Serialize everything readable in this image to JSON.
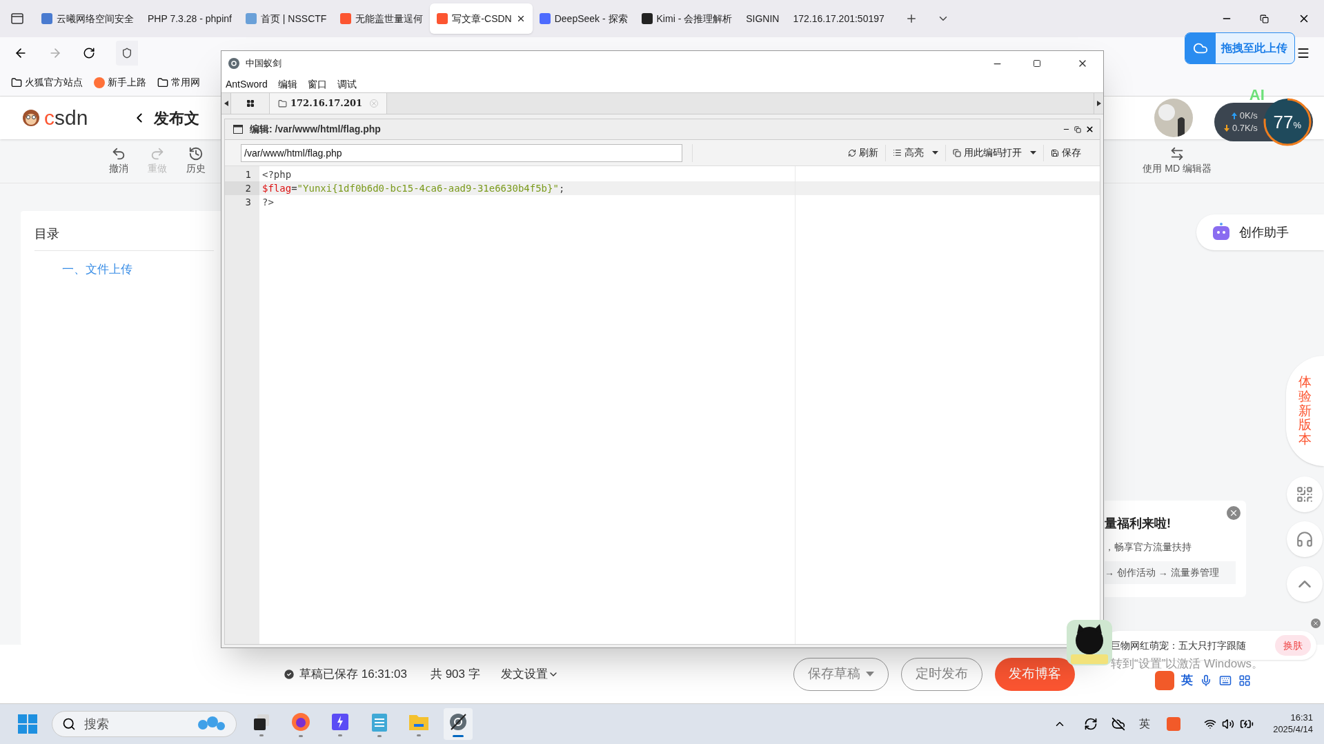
{
  "browser": {
    "tabs": [
      {
        "title": "云曦网络空间安全",
        "selected": false,
        "color": "#4a7bd0"
      },
      {
        "title": "PHP 7.3.28 - phpinf",
        "selected": false
      },
      {
        "title": "首页 | NSSCTF",
        "selected": false,
        "color": "#6aa0d8"
      },
      {
        "title": "无能盖世量逞何",
        "selected": false,
        "color": "#fc5531"
      },
      {
        "title": "写文章-CSDN",
        "selected": true,
        "color": "#fc5531"
      },
      {
        "title": "DeepSeek - 探索",
        "selected": false,
        "color": "#4d6bfe"
      },
      {
        "title": "Kimi - 会推理解析",
        "selected": false,
        "color": "#222222"
      },
      {
        "title": "SIGNIN",
        "selected": false
      },
      {
        "title": "172.16.17.201:50197",
        "selected": false
      }
    ],
    "bookmarks": [
      "火狐官方站点",
      "新手上路",
      "常用网"
    ],
    "upload_button": "拖拽至此上传"
  },
  "csdn": {
    "logo": "csdn",
    "page_title": "发布文",
    "toolbar": [
      {
        "label": "撤消",
        "disabled": false
      },
      {
        "label": "重做",
        "disabled": true
      },
      {
        "label": "历史",
        "disabled": false
      }
    ],
    "md_editor": "使用 MD 编辑器",
    "toc": {
      "title": "目录",
      "items": [
        "一、文件上传"
      ]
    },
    "assistant": "创作助手",
    "side_tabs": "体验新版本",
    "status": {
      "saved": "草稿已保存 16:31:03",
      "count": "共 903 字",
      "settings": "发文设置"
    },
    "buttons": [
      {
        "label": "保存草稿",
        "kind": "dropdown"
      },
      {
        "label": "定时发布",
        "kind": "outline"
      },
      {
        "label": "发布博客",
        "kind": "primary"
      }
    ],
    "promo": {
      "title": "量福利来啦!",
      "line": "，畅享官方流量扶持",
      "path": "→ 创作活动 → 流量券管理"
    }
  },
  "net_widget": {
    "badge": "AI",
    "up": "0K/s",
    "down": "0.7K/s",
    "percent": "77",
    "unit": "%"
  },
  "antsword": {
    "title": "中国蚁剑",
    "menu": [
      "AntSword",
      "编辑",
      "窗口",
      "调试"
    ],
    "tab": "172.16.17.201",
    "panel_title": "编辑: /var/www/html/flag.php",
    "path": "/var/www/html/flag.php",
    "actions": [
      {
        "label": "刷新",
        "kind": "refresh"
      },
      {
        "label": "高亮",
        "kind": "list-dropdown"
      },
      {
        "label": "用此编码打开",
        "kind": "encoding-dropdown"
      },
      {
        "label": "保存",
        "kind": "save"
      }
    ],
    "lines": [
      {
        "number": "1",
        "current": false,
        "tokens": [
          {
            "text": "<?php",
            "kind": "plain"
          }
        ]
      },
      {
        "number": "2",
        "current": true,
        "tokens": [
          {
            "text": "$flag",
            "kind": "variable"
          },
          {
            "text": "=",
            "kind": "operator"
          },
          {
            "text": "\"Yunxi{1df0b6d0-bc15-4ca6-aad9-31e6630b4f5b}\"",
            "kind": "string"
          },
          {
            "text": ";",
            "kind": "plain"
          }
        ]
      },
      {
        "number": "3",
        "current": false,
        "tokens": [
          {
            "text": "?>",
            "kind": "plain"
          }
        ]
      }
    ]
  },
  "sticker": {
    "text": "巨物网红萌宠：五大只打字跟随",
    "button": "换肤"
  },
  "activation": "转到“设置”以激活 Windows。",
  "ime": {
    "mode": "英"
  },
  "taskbar": {
    "search": "搜索",
    "apps": [
      {
        "kind": "taskview",
        "active": false
      },
      {
        "kind": "firefox",
        "active": false
      },
      {
        "kind": "bolt",
        "active": false
      },
      {
        "kind": "notepad",
        "active": false
      },
      {
        "kind": "folder",
        "active": false
      },
      {
        "kind": "antsword",
        "active": true
      }
    ],
    "tray_ime": "英",
    "time": "16:31",
    "date": "2025/4/14"
  }
}
